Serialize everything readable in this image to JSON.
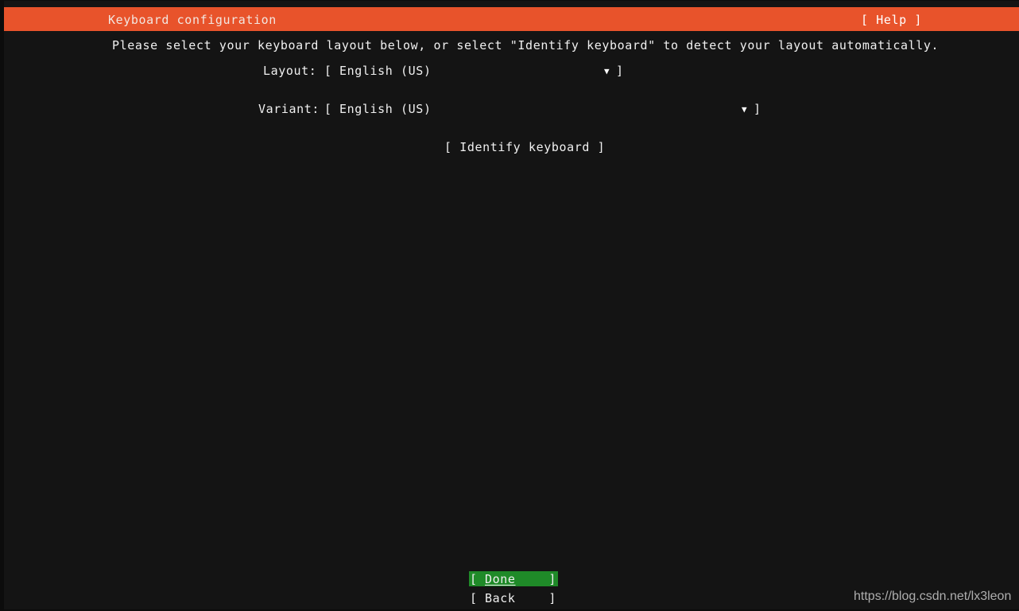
{
  "window": {
    "title": "Keyboard configuration",
    "help_label": "[ Help ]",
    "header_color": "#e8532b",
    "background_color": "#141414",
    "text_color": "#f0f0f0"
  },
  "main": {
    "instruction": "Please select your keyboard layout below, or select \"Identify keyboard\" to detect your layout automatically.",
    "fields": [
      {
        "name": "layout",
        "label": "Layout:",
        "bracket_open": "[",
        "value": "English (US)",
        "caret": "▼",
        "bracket_close": "]"
      },
      {
        "name": "variant",
        "label": "Variant:",
        "bracket_open": "[",
        "value": "English (US)",
        "caret": "▼",
        "bracket_close": "]"
      }
    ],
    "identify_button": "[ Identify keyboard ]"
  },
  "footer": {
    "buttons": [
      {
        "name": "done",
        "bracket_left": "[",
        "label": "Done",
        "bracket_right": "]",
        "selected": true,
        "highlight_color": "#1f8a28"
      },
      {
        "name": "back",
        "bracket_left": "[",
        "label": "Back",
        "bracket_right": "]",
        "selected": false,
        "highlight_color": ""
      }
    ]
  },
  "watermark": {
    "text": "https://blog.csdn.net/lx3leon"
  }
}
